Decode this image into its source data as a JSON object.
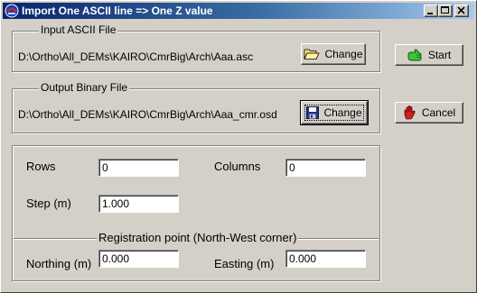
{
  "window": {
    "title": "Import One ASCII line => One Z value"
  },
  "input_group": {
    "legend": "Input ASCII File",
    "path": "D:\\Ortho\\All_DEMs\\KAIRO\\CmrBig\\Arch\\Aaa.asc",
    "change_label": "Change"
  },
  "output_group": {
    "legend": "Output Binary File",
    "path": "D:\\Ortho\\All_DEMs\\KAIRO\\CmrBig\\Arch\\Aaa_cmr.osd",
    "change_label": "Change"
  },
  "actions": {
    "start_label": "Start",
    "cancel_label": "Cancel"
  },
  "grid": {
    "rows_label": "Rows",
    "rows_value": "0",
    "columns_label": "Columns",
    "columns_value": "0",
    "step_label": "Step (m)",
    "step_value": "1.000"
  },
  "registration": {
    "heading": "Registration point (North-West corner)",
    "northing_label": "Northing (m)",
    "northing_value": "0.000",
    "easting_label": "Easting (m)",
    "easting_value": "0.000"
  },
  "icons": {
    "app": "app-logo-icon",
    "open_folder": "folder-open-icon",
    "save": "floppy-disk-icon",
    "start": "green-hand-icon",
    "cancel": "red-hand-icon"
  },
  "colors": {
    "titlebar_start": "#0a246a",
    "titlebar_end": "#a6caf0",
    "face": "#d4d0c8"
  }
}
